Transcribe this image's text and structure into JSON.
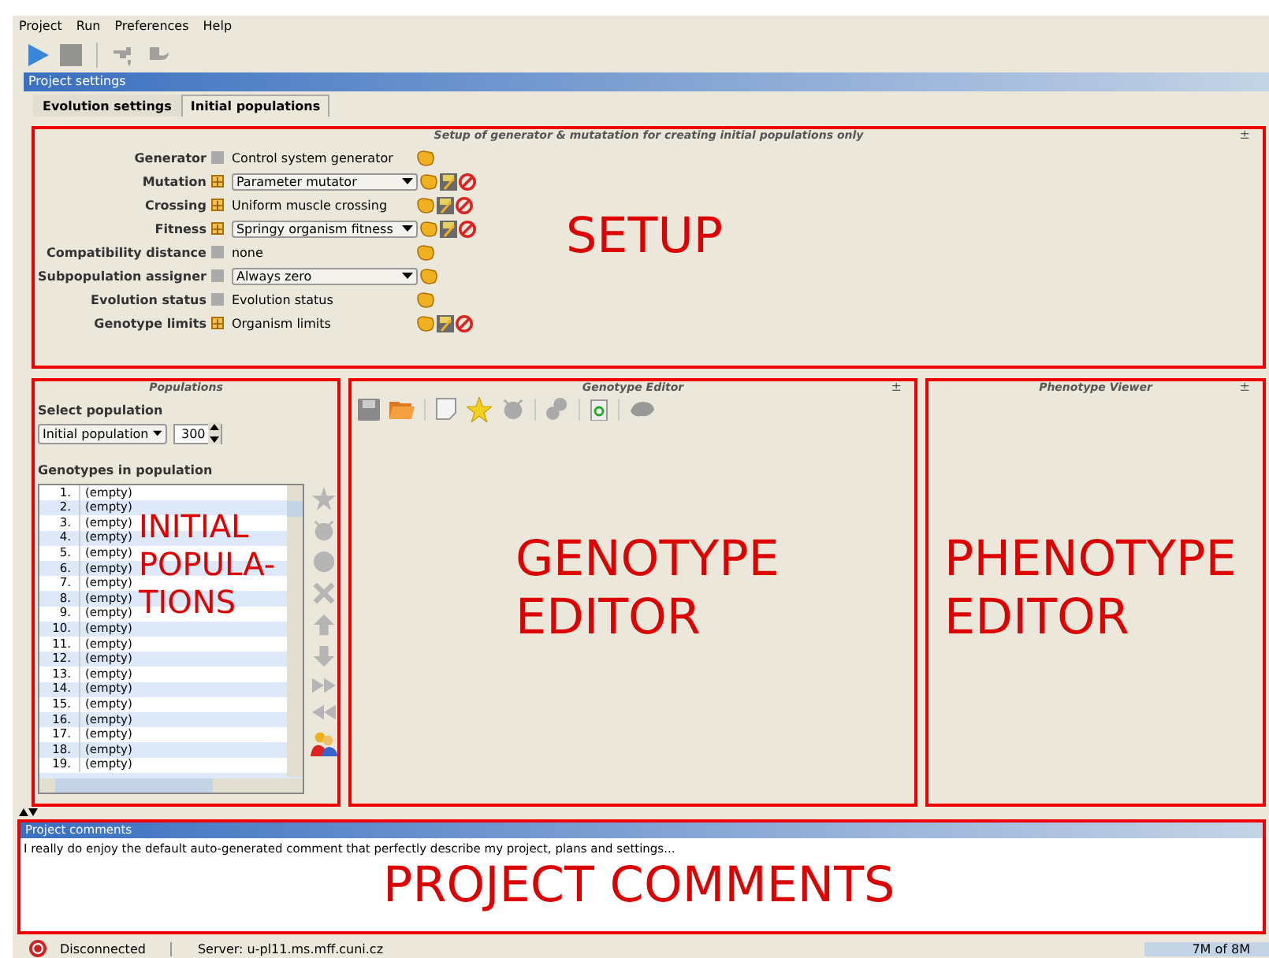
{
  "menu": [
    "Project",
    "Run",
    "Preferences",
    "Help"
  ],
  "toolbar": [
    {
      "kind": "play",
      "disabled": false
    },
    {
      "kind": "stop",
      "disabled": true
    },
    {
      "kind": "step",
      "disabled": true
    },
    {
      "kind": "rewind",
      "disabled": true
    }
  ],
  "panel_title": "Project settings",
  "tabs": [
    {
      "label": "Evolution settings",
      "selected": false
    },
    {
      "label": "Initial populations",
      "selected": true
    }
  ],
  "setup": {
    "title": "Setup of generator & mutatation for creating initial populations only",
    "collapse": "±",
    "annotation": "SETUP",
    "rows": [
      {
        "label": "Generator",
        "kind": "text",
        "value": "Control system generator",
        "expandable": false,
        "editable": false
      },
      {
        "label": "Mutation",
        "kind": "dropdown",
        "value": "Parameter mutator",
        "expandable": true,
        "editable": true
      },
      {
        "label": "Crossing",
        "kind": "text",
        "value": "Uniform muscle crossing",
        "expandable": true,
        "editable": true
      },
      {
        "label": "Fitness",
        "kind": "dropdown",
        "value": "Springy organism fitness",
        "expandable": true,
        "editable": true
      },
      {
        "label": "Compatibility distance",
        "kind": "text",
        "value": "none",
        "expandable": false,
        "editable": false
      },
      {
        "label": "Subpopulation assigner",
        "kind": "dropdown",
        "value": "Always zero",
        "expandable": false,
        "editable": false
      },
      {
        "label": "Evolution status",
        "kind": "text",
        "value": "Evolution status",
        "expandable": false,
        "editable": false
      },
      {
        "label": "Genotype limits",
        "kind": "text",
        "value": "Organism limits",
        "expandable": true,
        "editable": true
      }
    ]
  },
  "populations": {
    "title": "Populations",
    "annotation": "INITIAL\nPOPULA-\nTIONS",
    "select_label": "Select population",
    "dropdown": "Initial population",
    "count": "300",
    "list_label": "Genotypes in population",
    "genotypes": [
      {
        "index": "1.",
        "name": "(empty)"
      },
      {
        "index": "2.",
        "name": "(empty)"
      },
      {
        "index": "3.",
        "name": "(empty)"
      },
      {
        "index": "4.",
        "name": "(empty)"
      },
      {
        "index": "5.",
        "name": "(empty)"
      },
      {
        "index": "6.",
        "name": "(empty)"
      },
      {
        "index": "7.",
        "name": "(empty)"
      },
      {
        "index": "8.",
        "name": "(empty)"
      },
      {
        "index": "9.",
        "name": "(empty)"
      },
      {
        "index": "10.",
        "name": "(empty)"
      },
      {
        "index": "11.",
        "name": "(empty)"
      },
      {
        "index": "12.",
        "name": "(empty)"
      },
      {
        "index": "13.",
        "name": "(empty)"
      },
      {
        "index": "14.",
        "name": "(empty)"
      },
      {
        "index": "15.",
        "name": "(empty)"
      },
      {
        "index": "16.",
        "name": "(empty)"
      },
      {
        "index": "17.",
        "name": "(empty)"
      },
      {
        "index": "18.",
        "name": "(empty)"
      },
      {
        "index": "19.",
        "name": "(empty)"
      }
    ]
  },
  "genotype_editor": {
    "title": "Genotype Editor",
    "collapse": "±",
    "annotation": "GENOTYPE\nEDITOR"
  },
  "phenotype_viewer": {
    "title": "Phenotype Viewer",
    "collapse": "±",
    "annotation": "PHENOTYPE\nEDITOR"
  },
  "comments": {
    "title": "Project comments",
    "text": "I really do enjoy the default auto-generated comment that perfectly describe my project, plans and settings...",
    "annotation": "PROJECT COMMENTS"
  },
  "status": {
    "connection": "Disconnected",
    "server": "Server: u-pl11.ms.mff.cuni.cz",
    "memory": "7M of 8M"
  }
}
